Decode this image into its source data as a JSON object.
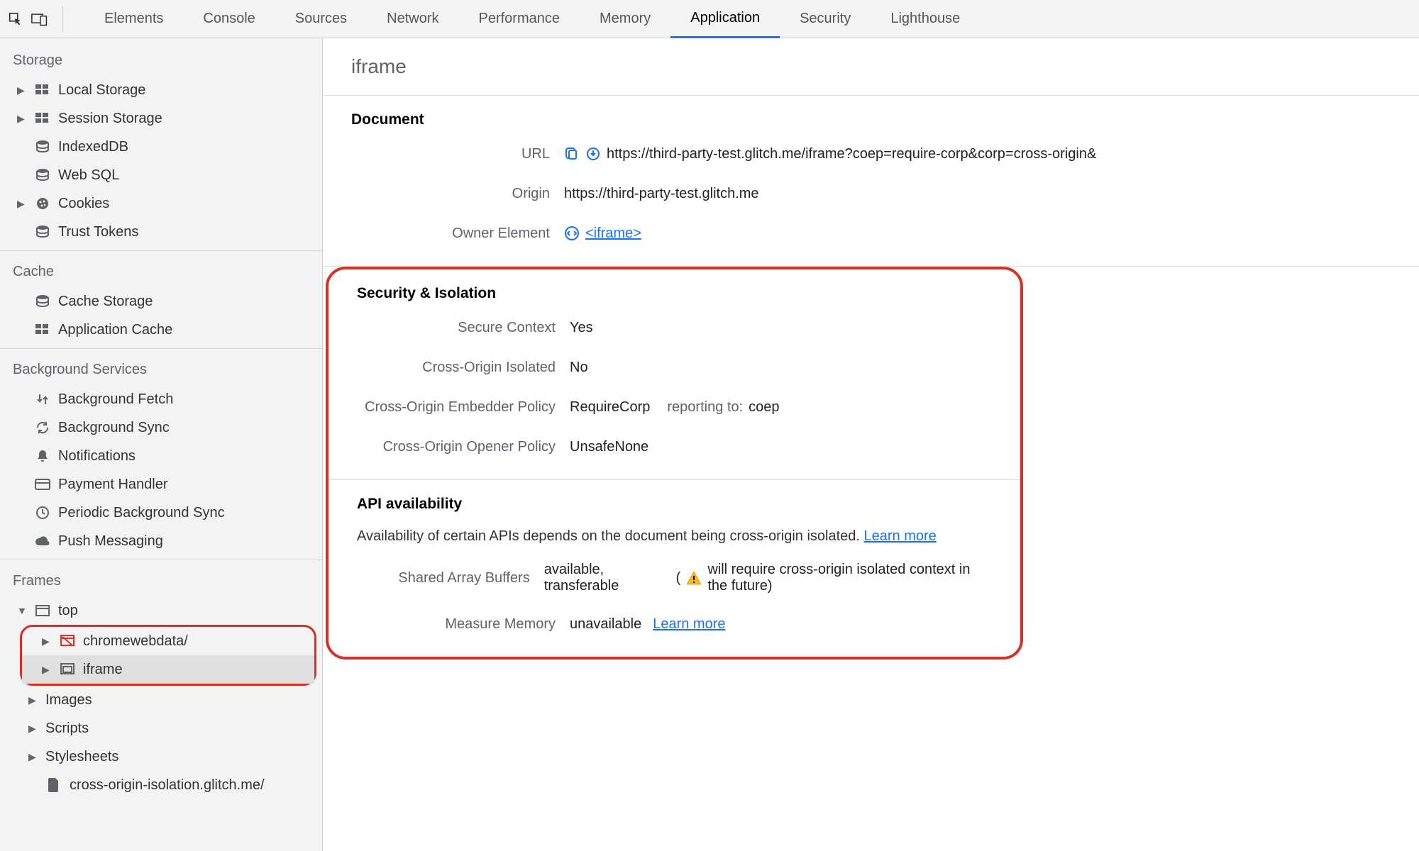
{
  "toolbar": {
    "tabs": [
      "Elements",
      "Console",
      "Sources",
      "Network",
      "Performance",
      "Memory",
      "Application",
      "Security",
      "Lighthouse"
    ],
    "activeTab": "Application"
  },
  "sidebar": {
    "storage": {
      "title": "Storage",
      "items": [
        "Local Storage",
        "Session Storage",
        "IndexedDB",
        "Web SQL",
        "Cookies",
        "Trust Tokens"
      ]
    },
    "cache": {
      "title": "Cache",
      "items": [
        "Cache Storage",
        "Application Cache"
      ]
    },
    "bgservices": {
      "title": "Background Services",
      "items": [
        "Background Fetch",
        "Background Sync",
        "Notifications",
        "Payment Handler",
        "Periodic Background Sync",
        "Push Messaging"
      ]
    },
    "frames": {
      "title": "Frames",
      "top": "top",
      "children": {
        "chromewebdata": "chromewebdata/",
        "iframe": "iframe",
        "images": "Images",
        "scripts": "Scripts",
        "stylesheets": "Stylesheets",
        "glitch": "cross-origin-isolation.glitch.me/"
      }
    }
  },
  "main": {
    "title": "iframe",
    "document": {
      "heading": "Document",
      "url_label": "URL",
      "url_value": "https://third-party-test.glitch.me/iframe?coep=require-corp&corp=cross-origin&",
      "origin_label": "Origin",
      "origin_value": "https://third-party-test.glitch.me",
      "owner_label": "Owner Element",
      "owner_link": "<iframe>"
    },
    "security": {
      "heading": "Security & Isolation",
      "secure_label": "Secure Context",
      "secure_value": "Yes",
      "coi_label": "Cross-Origin Isolated",
      "coi_value": "No",
      "coep_label": "Cross-Origin Embedder Policy",
      "coep_value": "RequireCorp",
      "coep_reporting_label": "reporting to:",
      "coep_reporting_value": "coep",
      "coop_label": "Cross-Origin Opener Policy",
      "coop_value": "UnsafeNone"
    },
    "api": {
      "heading": "API availability",
      "desc": "Availability of certain APIs depends on the document being cross-origin isolated.",
      "learn_more": "Learn more",
      "sab_label": "Shared Array Buffers",
      "sab_value": "available, transferable",
      "sab_warn": "will require cross-origin isolated context in the future)",
      "mm_label": "Measure Memory",
      "mm_value": "unavailable",
      "mm_link": "Learn more"
    }
  }
}
